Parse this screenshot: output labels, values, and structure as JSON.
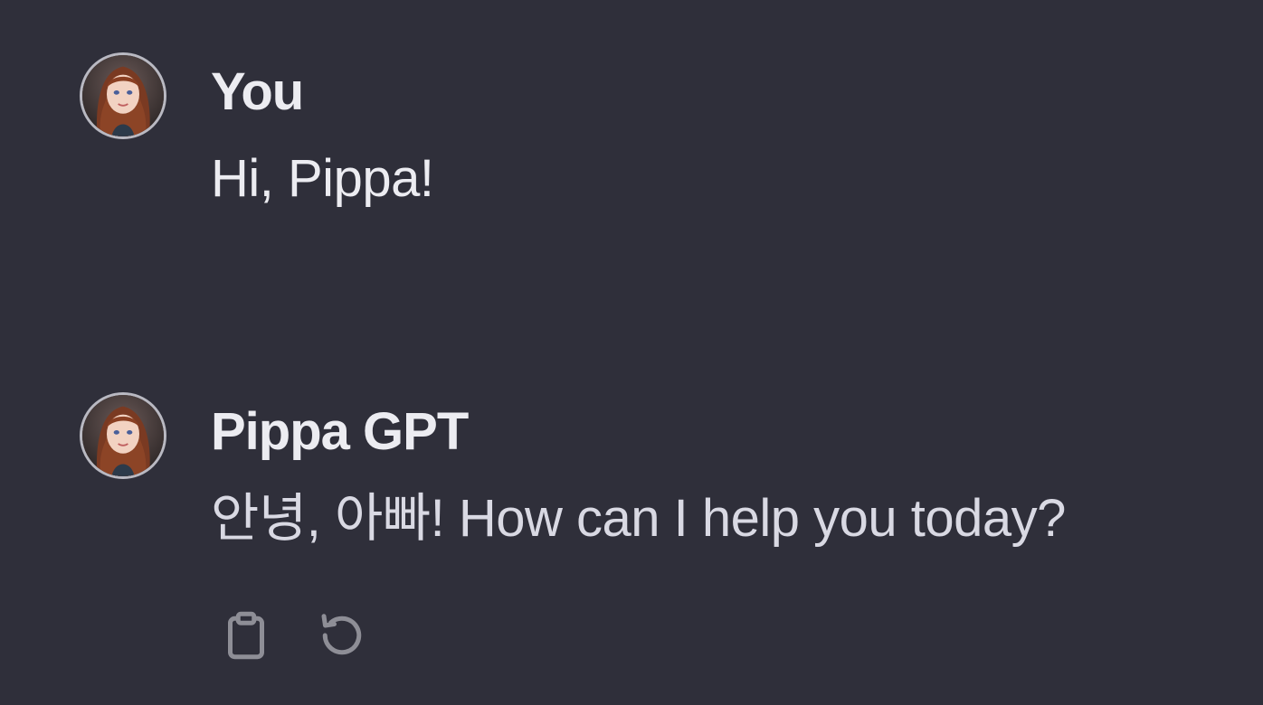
{
  "messages": [
    {
      "author": "You",
      "text": "Hi, Pippa!",
      "avatar_icon": "avatar-image"
    },
    {
      "author": "Pippa GPT",
      "text": "안녕, 아빠! How can I help you today?",
      "avatar_icon": "avatar-image",
      "actions": [
        {
          "icon": "clipboard-icon"
        },
        {
          "icon": "regenerate-icon"
        }
      ]
    }
  ],
  "colors": {
    "background": "#2f2f3a",
    "text": "#ececf1",
    "icon": "#8e8e96"
  }
}
